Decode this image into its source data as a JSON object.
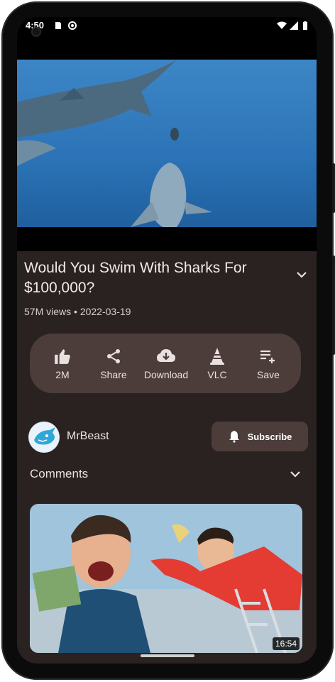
{
  "status_bar": {
    "time": "4:50",
    "icons": [
      "sim-card-icon",
      "data-saver-icon",
      "wifi-icon",
      "signal-icon",
      "battery-icon"
    ]
  },
  "video": {
    "title": "Would You Swim With Sharks For $100,000?",
    "views": "57M views",
    "date": "2022-03-19",
    "meta_separator": " • "
  },
  "actions": [
    {
      "icon": "thumbs-up-icon",
      "label": "2M"
    },
    {
      "icon": "share-icon",
      "label": "Share"
    },
    {
      "icon": "download-icon",
      "label": "Download"
    },
    {
      "icon": "vlc-cone-icon",
      "label": "VLC"
    },
    {
      "icon": "playlist-add-icon",
      "label": "Save"
    }
  ],
  "channel": {
    "name": "MrBeast",
    "subscribe_label": "Subscribe"
  },
  "comments": {
    "label": "Comments"
  },
  "next_video": {
    "duration": "16:54"
  },
  "colors": {
    "background": "#2a2221",
    "pill": "#4c3d3b",
    "text": "#e9e1e0"
  }
}
